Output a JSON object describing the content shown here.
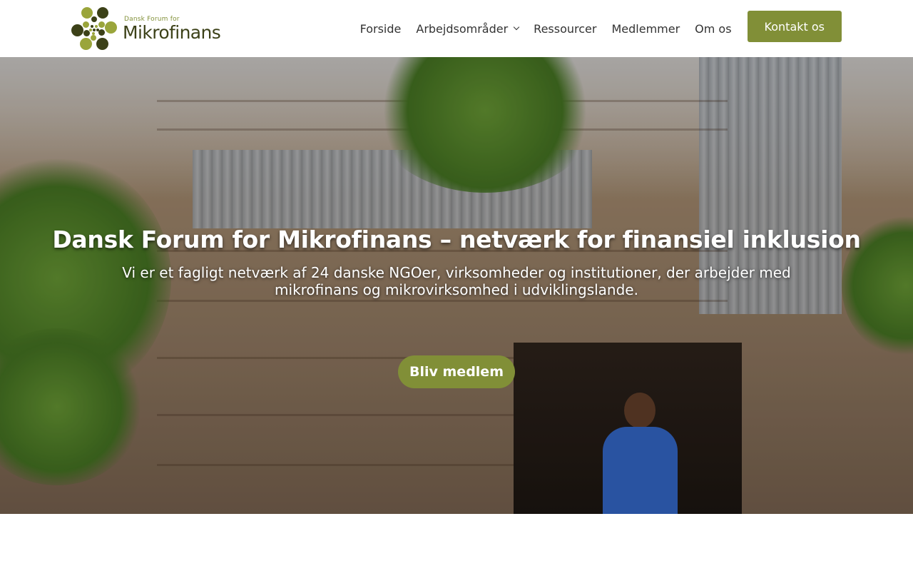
{
  "logo": {
    "small_text": "Dansk Forum for",
    "big_text": "Mikrofinans"
  },
  "nav": {
    "items": [
      {
        "label": "Forside"
      },
      {
        "label": "Arbejdsområder"
      },
      {
        "label": "Ressourcer"
      },
      {
        "label": "Medlemmer"
      },
      {
        "label": "Om os"
      }
    ],
    "cta_label": "Kontakt os"
  },
  "hero": {
    "title": "Dansk Forum for Mikrofinans – netværk for finansiel inklusion",
    "subtitle": "Vi er et fagligt netværk af 24 danske NGOer, virksomheder og institutioner, der arbejder med mikrofinans og mikrovirksomhed i udviklingslande.",
    "button_label": "Bliv medlem"
  },
  "colors": {
    "accent": "#818f37",
    "logo_dark": "#3c4118",
    "nav_text": "#333333"
  },
  "icons": {
    "dropdown": "chevron-down-icon",
    "logo_mark": "logo-dots-icon"
  }
}
